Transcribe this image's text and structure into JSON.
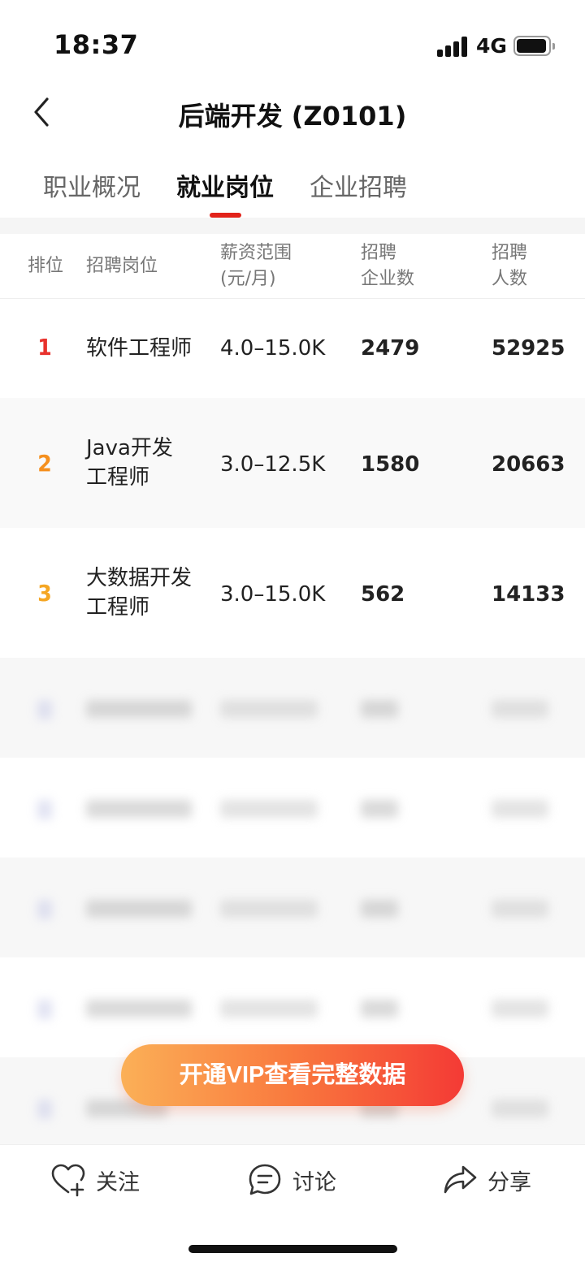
{
  "status_bar": {
    "time": "18:37",
    "network": "4G"
  },
  "header": {
    "title": "后端开发 (Z0101)"
  },
  "tabs": [
    {
      "label": "职业概况",
      "active": false
    },
    {
      "label": "就业岗位",
      "active": true
    },
    {
      "label": "企业招聘",
      "active": false
    }
  ],
  "table": {
    "headers": {
      "rank": "排位",
      "position": "招聘岗位",
      "salary_line1": "薪资范围",
      "salary_line2": "(元/月)",
      "companies_line1": "招聘",
      "companies_line2": "企业数",
      "people_line1": "招聘",
      "people_line2": "人数"
    },
    "rows": [
      {
        "rank": "1",
        "rank_color": "#e8322d",
        "position_line1": "软件工程师",
        "position_line2": "",
        "salary": "4.0–15.0K",
        "companies": "2479",
        "people": "52925"
      },
      {
        "rank": "2",
        "rank_color": "#f5901e",
        "position_line1": "Java开发",
        "position_line2": "工程师",
        "salary": "3.0–12.5K",
        "companies": "1580",
        "people": "20663"
      },
      {
        "rank": "3",
        "rank_color": "#f5a623",
        "position_line1": "大数据开发",
        "position_line2": "工程师",
        "salary": "3.0–15.0K",
        "companies": "562",
        "people": "14133"
      }
    ]
  },
  "vip_button": {
    "label": "开通VIP查看完整数据"
  },
  "bottom_bar": {
    "follow": {
      "label": "关注",
      "icon": "heart-plus-icon"
    },
    "discuss": {
      "label": "讨论",
      "icon": "chat-bubble-icon"
    },
    "share": {
      "label": "分享",
      "icon": "share-arrow-icon"
    }
  },
  "colors": {
    "accent": "#e2231a",
    "vip_start": "#fbb057",
    "vip_end": "#f43a35"
  }
}
